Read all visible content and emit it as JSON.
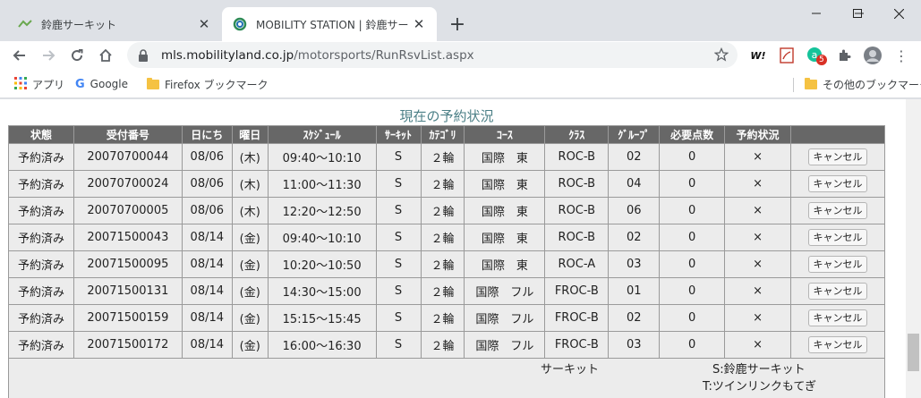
{
  "browser": {
    "tabs": [
      {
        "title": "鈴鹿サーキット",
        "active": false
      },
      {
        "title": "MOBILITY STATION | 鈴鹿サーキット",
        "active": true
      }
    ],
    "new_tab_label": "+",
    "url_host": "mls.mobilityland.co.jp",
    "url_path": "/motorsports/RunRsvList.aspx",
    "extension_badge": "5",
    "extension_w_label": "W!",
    "bookmarks": {
      "apps": "アプリ",
      "google": "Google",
      "firefox": "Firefox ブックマーク",
      "other": "その他のブックマーク"
    }
  },
  "page": {
    "title": "現在の予約状況",
    "table": {
      "headers": [
        "状態",
        "受付番号",
        "日にち",
        "曜日",
        "ｽｹｼﾞｭｰﾙ",
        "ｻｰｷｯﾄ",
        "ｶﾃｺﾞﾘ",
        "ｺｰｽ",
        "ｸﾗｽ",
        "ｸﾞﾙｰﾌﾟ",
        "必要点数",
        "予約状況",
        ""
      ],
      "rows": [
        [
          "予約済み",
          "20070700044",
          "08/06",
          "(木)",
          "09:40～10:10",
          "S",
          "２輪",
          "国際　東",
          "ROC-B",
          "02",
          "0",
          "×"
        ],
        [
          "予約済み",
          "20070700024",
          "08/06",
          "(木)",
          "11:00～11:30",
          "S",
          "２輪",
          "国際　東",
          "ROC-B",
          "04",
          "0",
          "×"
        ],
        [
          "予約済み",
          "20070700005",
          "08/06",
          "(木)",
          "12:20～12:50",
          "S",
          "２輪",
          "国際　東",
          "ROC-B",
          "06",
          "0",
          "×"
        ],
        [
          "予約済み",
          "20071500043",
          "08/14",
          "(金)",
          "09:40～10:10",
          "S",
          "２輪",
          "国際　東",
          "ROC-B",
          "02",
          "0",
          "×"
        ],
        [
          "予約済み",
          "20071500095",
          "08/14",
          "(金)",
          "10:20～10:50",
          "S",
          "２輪",
          "国際　東",
          "ROC-A",
          "03",
          "0",
          "×"
        ],
        [
          "予約済み",
          "20071500131",
          "08/14",
          "(金)",
          "14:30～15:00",
          "S",
          "２輪",
          "国際　フル",
          "FROC-B",
          "01",
          "0",
          "×"
        ],
        [
          "予約済み",
          "20071500159",
          "08/14",
          "(金)",
          "15:15～15:45",
          "S",
          "２輪",
          "国際　フル",
          "FROC-B",
          "02",
          "0",
          "×"
        ],
        [
          "予約済み",
          "20071500172",
          "08/14",
          "(金)",
          "16:00～16:30",
          "S",
          "２輪",
          "国際　フル",
          "FROC-B",
          "03",
          "0",
          "×"
        ]
      ],
      "cancel_label": "キャンセル"
    },
    "legend": {
      "circuit_label": "サーキット",
      "s_meaning": "S:鈴鹿サーキット",
      "t_meaning": "T:ツインリンクもてぎ"
    }
  },
  "colors": {
    "header_bg": "#676767",
    "cell_bg": "#ececec",
    "title_color": "#4b7f86"
  }
}
